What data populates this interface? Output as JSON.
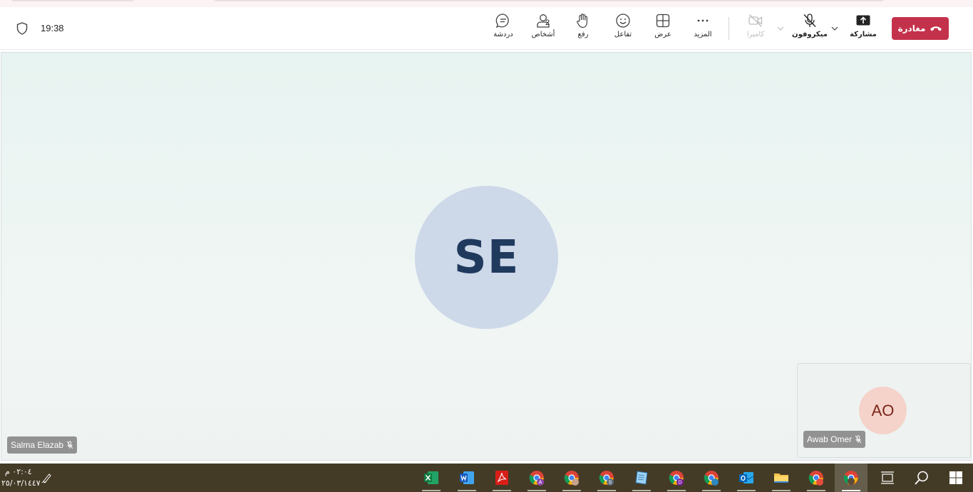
{
  "meeting": {
    "elapsed_time": "19:38",
    "toolbar": {
      "chat_label": "دردشة",
      "people_label": "أشخاص",
      "people_count": "2",
      "raise_label": "رفع",
      "react_label": "تفاعل",
      "view_label": "عرض",
      "more_label": "المزيد",
      "camera_label": "كاميرا",
      "mic_label": "ميكروفون",
      "share_label": "مشاركة",
      "leave_label": "مغادرة"
    },
    "main_participant": {
      "initials": "SE",
      "name": "Salma Elazab",
      "muted": true
    },
    "self_participant": {
      "initials": "AO",
      "name": "Awab Omer",
      "muted": true
    },
    "colors": {
      "leave": "#c4314b",
      "main_avatar_bg": "#cdd8e9",
      "main_avatar_text": "#203a5e",
      "self_avatar_bg": "#f5d3ca",
      "self_avatar_text": "#7a2518"
    }
  },
  "taskbar": {
    "time": "٠٢:٠٤ م",
    "date": "٢٥/٠٣/١٤٤٧",
    "apps": [
      {
        "name": "excel-icon",
        "badge": ""
      },
      {
        "name": "word-icon",
        "badge": ""
      },
      {
        "name": "acrobat-icon",
        "badge": ""
      },
      {
        "name": "chrome-profile-a-icon",
        "badge": "A"
      },
      {
        "name": "chrome-profile-photo-icon",
        "badge": ""
      },
      {
        "name": "chrome-profile-s-icon",
        "badge": "S"
      },
      {
        "name": "notepad-icon",
        "badge": ""
      },
      {
        "name": "chrome-profile-d-icon",
        "badge": "D"
      },
      {
        "name": "chrome-profile-arabic-icon",
        "badge": "ف"
      },
      {
        "name": "outlook-icon",
        "badge": ""
      },
      {
        "name": "file-explorer-icon",
        "badge": ""
      },
      {
        "name": "chrome-profile-red-icon",
        "badge": ""
      },
      {
        "name": "chrome-profile-active-icon",
        "badge": ""
      }
    ]
  }
}
